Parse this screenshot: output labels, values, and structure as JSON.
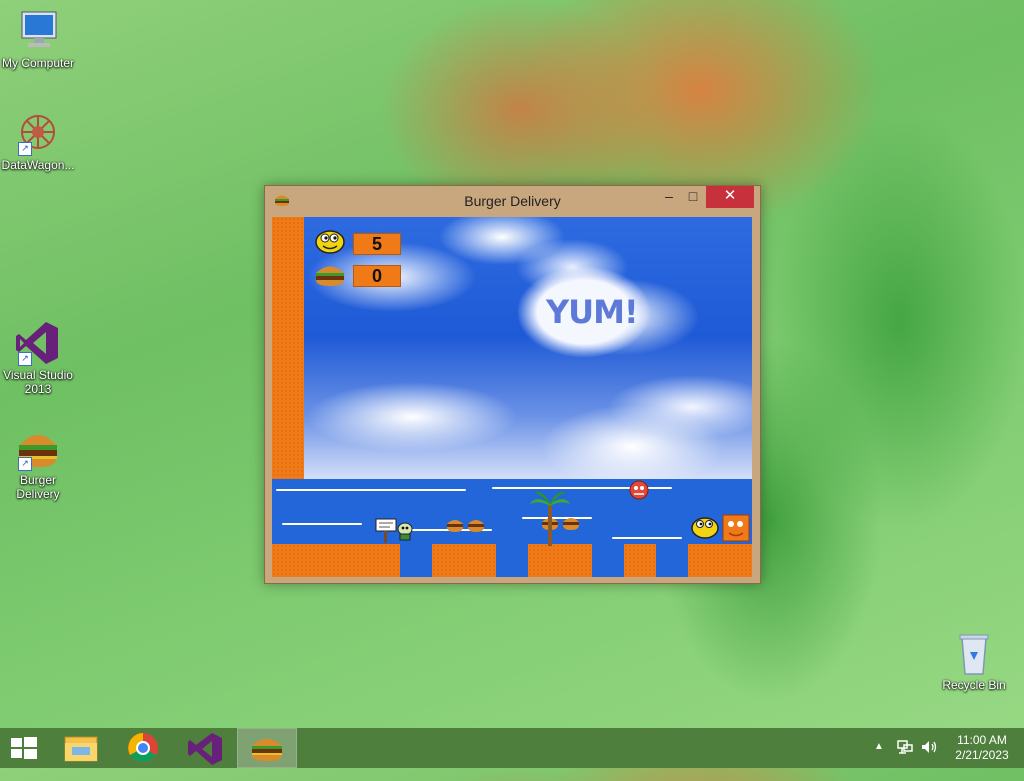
{
  "desktop": {
    "icons": [
      {
        "label": "My Computer"
      },
      {
        "label": "DataWagon..."
      },
      {
        "label": "Visual Studio 2013"
      },
      {
        "label": "Burger Delivery"
      },
      {
        "label": "Recycle Bin"
      }
    ]
  },
  "window": {
    "title": "Burger Delivery",
    "controls": {
      "minimize": "–",
      "maximize": "□",
      "close": "✕"
    }
  },
  "game": {
    "lives": "5",
    "burgers": "0",
    "yum_text": "YUM!",
    "colors": {
      "platform": "#f07a17",
      "water": "#2266d9"
    }
  },
  "taskbar": {
    "apps": [
      {
        "name": "start-button-icon"
      },
      {
        "name": "file-explorer-icon"
      },
      {
        "name": "chrome-icon"
      },
      {
        "name": "visual-studio-icon"
      },
      {
        "name": "burger-delivery-icon"
      }
    ],
    "clock": {
      "time": "11:00 AM",
      "date": "2/21/2023"
    }
  }
}
